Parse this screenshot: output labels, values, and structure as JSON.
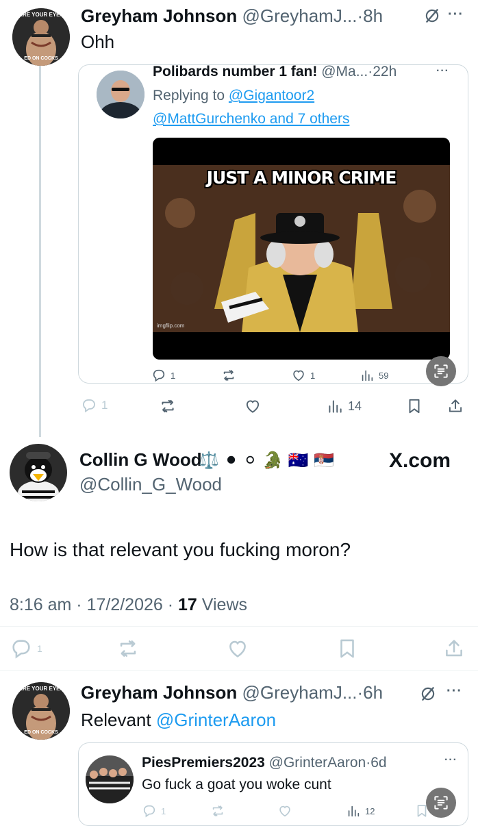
{
  "tweet1": {
    "name": "Greyham Johnson",
    "handle": "@GreyhamJ...",
    "time": "8h",
    "text": "Ohh",
    "avatar_top": "ARE YOUR EYES",
    "avatar_bottom": "ED ON COCKS",
    "quote": {
      "name": "Polibards number 1 fan!",
      "handle": "@Ma...",
      "time": "22h",
      "replying_prefix": "Replying to ",
      "replying_to": "@Gigantoor2",
      "others": "@MattGurchenko and 7 others",
      "meme_caption": "JUST A MINOR CRIME",
      "watermark": "imgflip.com",
      "replies": "1",
      "likes": "1",
      "views": "59"
    },
    "replies": "1",
    "views": "14"
  },
  "main": {
    "name": "Collin G Wood",
    "emojis": "⚖️ ⚫ ⚪ 🐊 🇦🇺 🇷🇸",
    "handle": "@Collin_G_Wood",
    "brand": "X.com",
    "text": "How is that relevant you fucking moron?",
    "time": "8:16 am",
    "date": "17/2/2026",
    "views_count": "17",
    "views_label": "Views",
    "replies": "1"
  },
  "tweet3": {
    "name": "Greyham Johnson",
    "handle": "@GreyhamJ...",
    "time": "6h",
    "text_prefix": "Relevant ",
    "mention": "@GrinterAaron",
    "avatar_top": "ARE YOUR EYES",
    "avatar_bottom": "ED ON COCKS",
    "quote": {
      "name": "PiesPremiers2023",
      "handle": "@GrinterAaron",
      "time": "6d",
      "text": "Go fuck a goat you woke cunt",
      "replies": "1",
      "views": "12"
    }
  },
  "colors": {
    "link": "#1d9bf0",
    "secondary": "#536471",
    "border": "#cfd9de"
  },
  "icons": [
    "reply-icon",
    "retweet-icon",
    "like-icon",
    "views-icon",
    "bookmark-icon",
    "share-icon",
    "grok-icon",
    "scan-icon",
    "more-icon"
  ]
}
